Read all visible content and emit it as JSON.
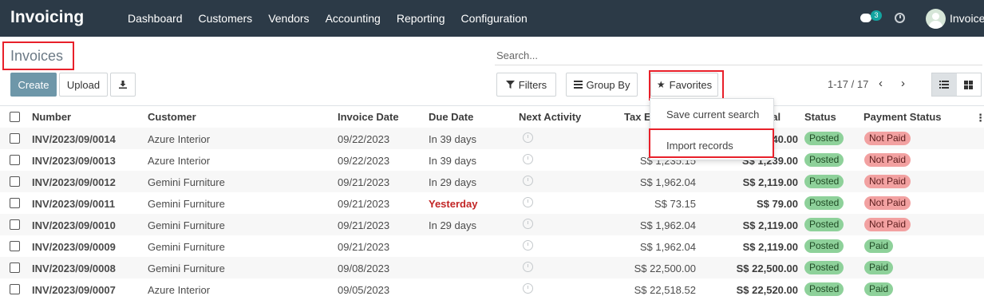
{
  "app": {
    "title": "Invoicing",
    "menu": [
      "Dashboard",
      "Customers",
      "Vendors",
      "Accounting",
      "Reporting",
      "Configuration"
    ],
    "chat_count": "3",
    "user_name": "Invoice"
  },
  "control": {
    "page_title": "Invoices",
    "search_placeholder": "Search...",
    "create_label": "Create",
    "upload_label": "Upload",
    "filters_label": "Filters",
    "groupby_label": "Group By",
    "favorites_label": "Favorites",
    "pager": "1-17 / 17"
  },
  "favorites_menu": {
    "save_current_search": "Save current search",
    "import_records": "Import records"
  },
  "table": {
    "headers": {
      "number": "Number",
      "customer": "Customer",
      "invoice_date": "Invoice Date",
      "due_date": "Due Date",
      "next_activity": "Next Activity",
      "tax_excluded": "Tax E",
      "total": "otal",
      "status": "Status",
      "payment_status": "Payment Status"
    },
    "rows": [
      {
        "number": "INV/2023/09/0014",
        "customer": "Azure Interior",
        "invoice_date": "09/22/2023",
        "due_date": "In 39 days",
        "tax_excluded": "",
        "total": "40.00",
        "status": "Posted",
        "payment": "Not Paid"
      },
      {
        "number": "INV/2023/09/0013",
        "customer": "Azure Interior",
        "invoice_date": "09/22/2023",
        "due_date": "In 39 days",
        "tax_excluded": "S$ 1,235.15",
        "total": "S$ 1,239.00",
        "status": "Posted",
        "payment": "Not Paid"
      },
      {
        "number": "INV/2023/09/0012",
        "customer": "Gemini Furniture",
        "invoice_date": "09/21/2023",
        "due_date": "In 29 days",
        "tax_excluded": "S$ 1,962.04",
        "total": "S$ 2,119.00",
        "status": "Posted",
        "payment": "Not Paid"
      },
      {
        "number": "INV/2023/09/0011",
        "customer": "Gemini Furniture",
        "invoice_date": "09/21/2023",
        "due_date": "Yesterday",
        "tax_excluded": "S$ 73.15",
        "total": "S$ 79.00",
        "status": "Posted",
        "payment": "Not Paid"
      },
      {
        "number": "INV/2023/09/0010",
        "customer": "Gemini Furniture",
        "invoice_date": "09/21/2023",
        "due_date": "In 29 days",
        "tax_excluded": "S$ 1,962.04",
        "total": "S$ 2,119.00",
        "status": "Posted",
        "payment": "Not Paid"
      },
      {
        "number": "INV/2023/09/0009",
        "customer": "Gemini Furniture",
        "invoice_date": "09/21/2023",
        "due_date": "",
        "tax_excluded": "S$ 1,962.04",
        "total": "S$ 2,119.00",
        "status": "Posted",
        "payment": "Paid"
      },
      {
        "number": "INV/2023/09/0008",
        "customer": "Gemini Furniture",
        "invoice_date": "09/08/2023",
        "due_date": "",
        "tax_excluded": "S$ 22,500.00",
        "total": "S$ 22,500.00",
        "status": "Posted",
        "payment": "Paid"
      },
      {
        "number": "INV/2023/09/0007",
        "customer": "Azure Interior",
        "invoice_date": "09/05/2023",
        "due_date": "",
        "tax_excluded": "S$ 22,518.52",
        "total": "S$ 22,520.00",
        "status": "Posted",
        "payment": "Paid"
      }
    ]
  }
}
